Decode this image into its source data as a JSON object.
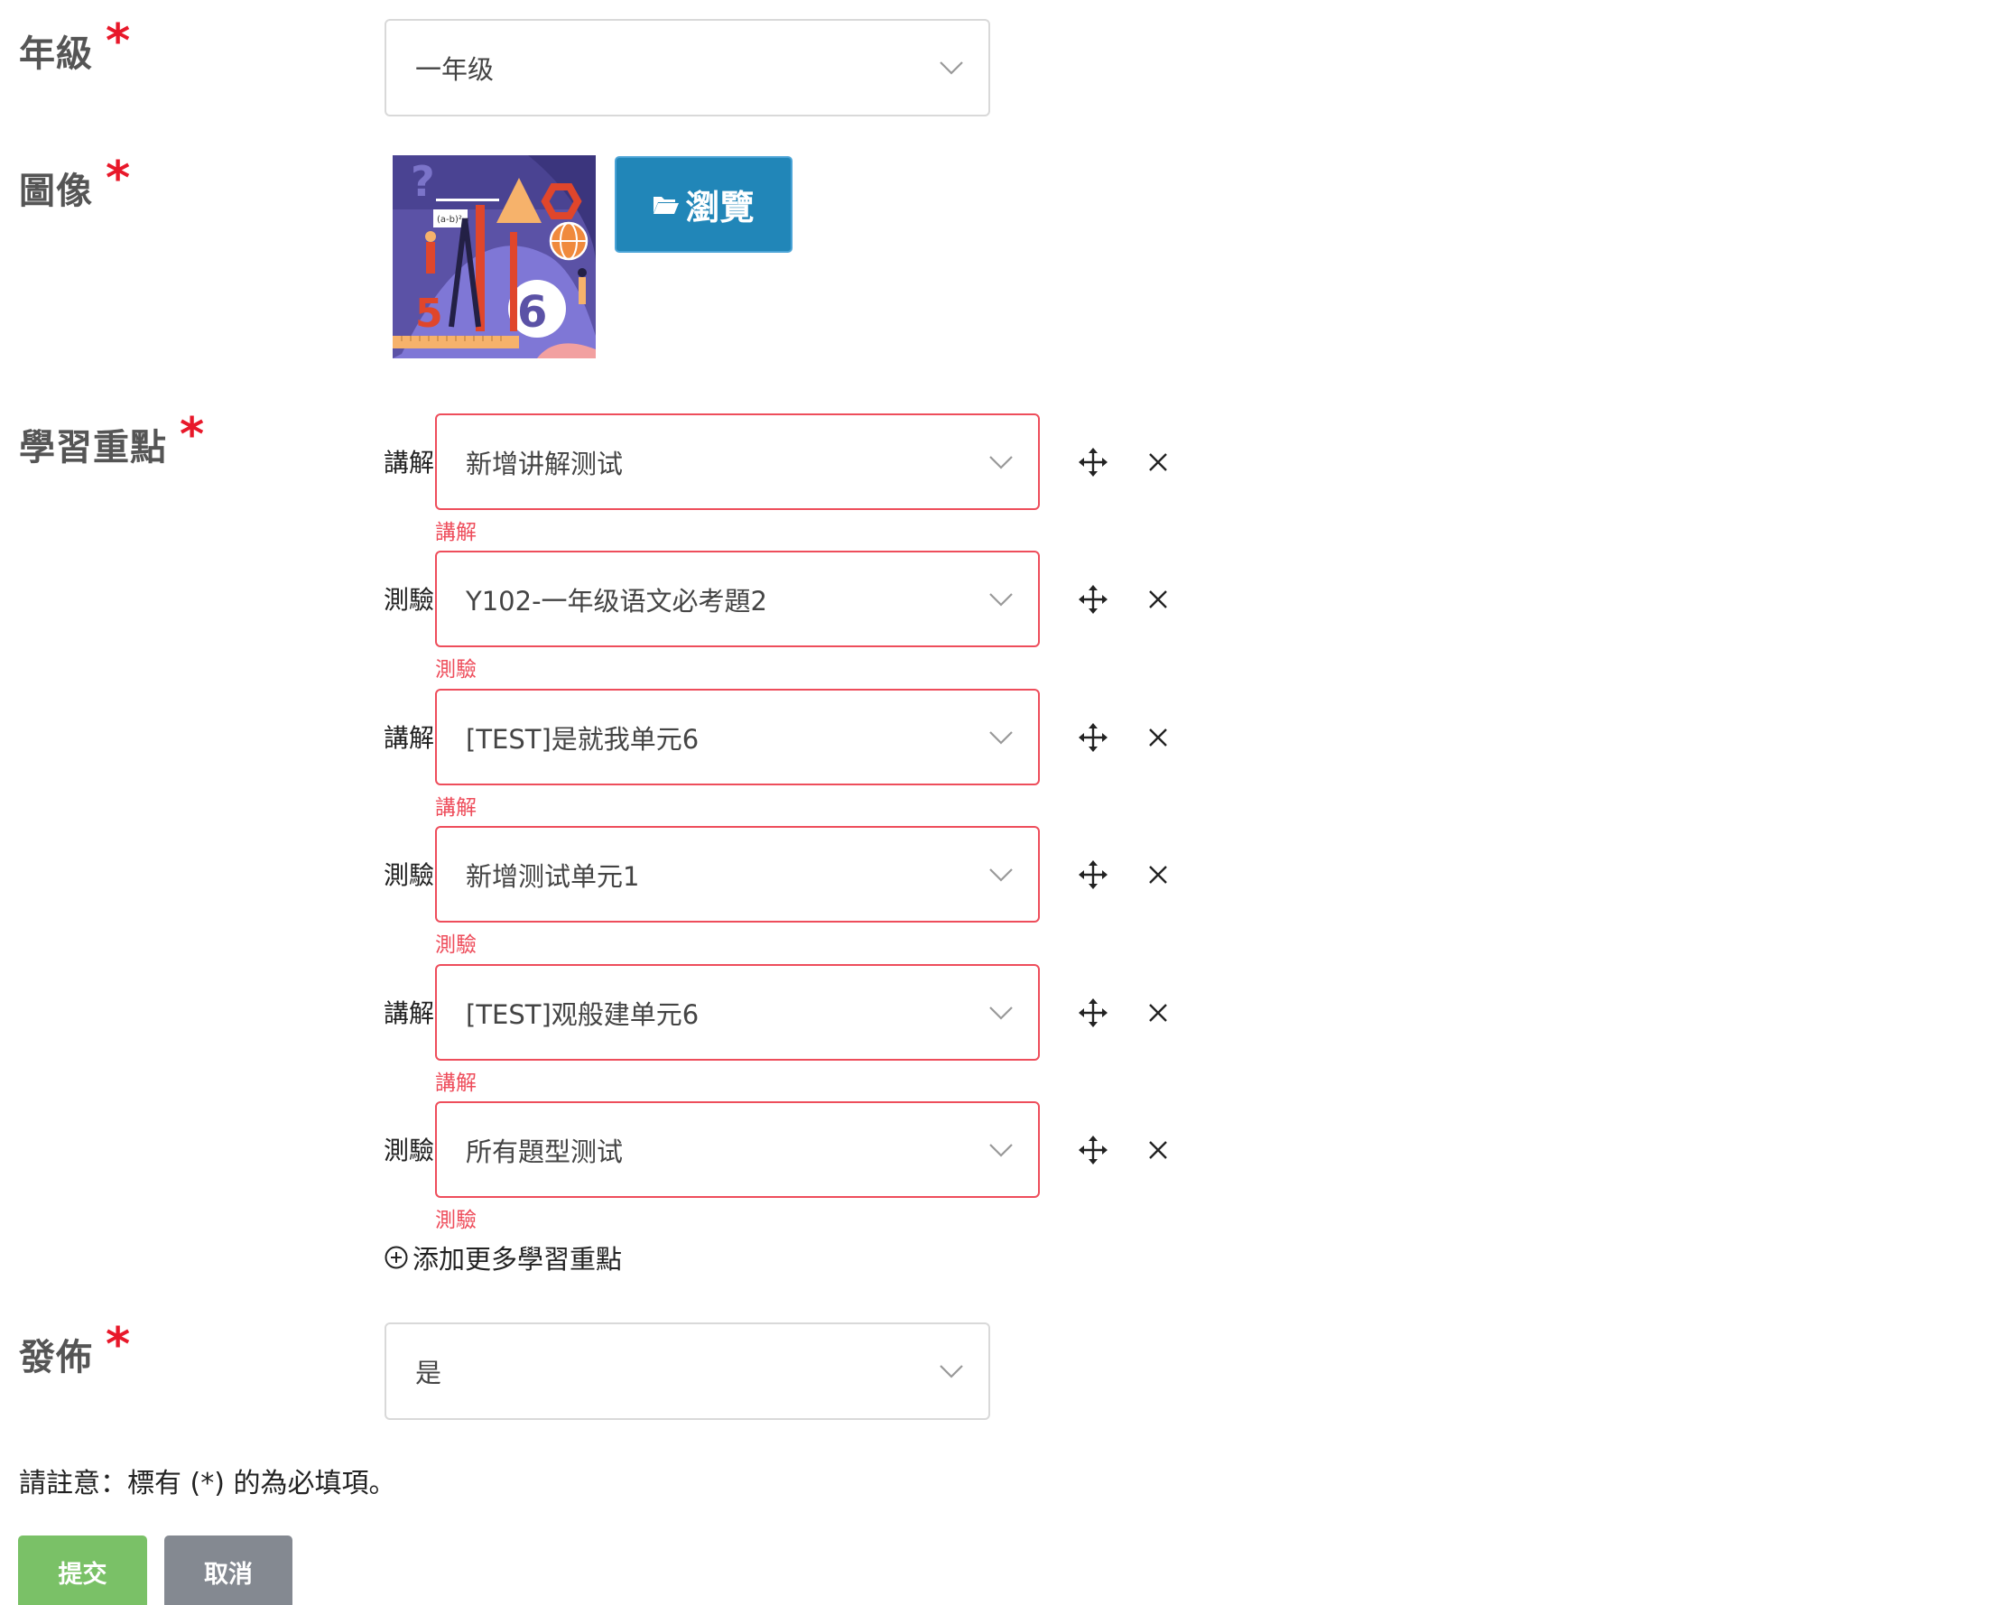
{
  "grade": {
    "label": "年級",
    "required_mark": "*",
    "value": "一年级"
  },
  "image": {
    "label": "圖像",
    "required_mark": "*",
    "browse_label": "瀏覽"
  },
  "learning_points": {
    "label": "學習重點",
    "required_mark": "*",
    "rows": [
      {
        "type": "講解",
        "value": "新增讲解测试",
        "error": "講解"
      },
      {
        "type": "測驗",
        "value": "Y102-一年级语文必考題2",
        "error": "測驗"
      },
      {
        "type": "講解",
        "value": "[TEST]是就我单元6",
        "error": "講解"
      },
      {
        "type": "測驗",
        "value": "新增测试单元1",
        "error": "測驗"
      },
      {
        "type": "講解",
        "value": "[TEST]观般建单元6",
        "error": "講解"
      },
      {
        "type": "測驗",
        "value": "所有題型测试",
        "error": "測驗"
      }
    ],
    "add_more_label": "添加更多學習重點"
  },
  "publish": {
    "label": "發佈",
    "required_mark": "*",
    "value": "是"
  },
  "note": "請註意：標有 (*) 的為必填項。",
  "actions": {
    "submit_label": "提交",
    "cancel_label": "取消"
  },
  "colors": {
    "required": "#e8182a",
    "error": "#ee4d5b",
    "browse": "#2186b8",
    "submit": "#7ac167",
    "cancel": "#848991"
  },
  "icons": {
    "drag": "move-icon",
    "remove": "close-icon",
    "folder": "folder-open-icon",
    "add": "plus-circle-icon",
    "dropdown": "chevron-down-icon"
  }
}
